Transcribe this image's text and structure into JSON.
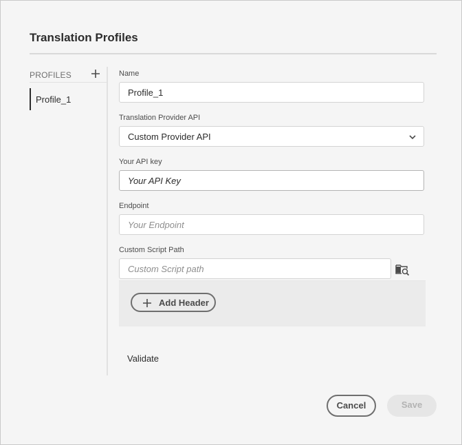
{
  "dialog": {
    "title": "Translation Profiles"
  },
  "sidebar": {
    "header_label": "PROFILES",
    "add_icon": "plus-icon",
    "items": [
      {
        "label": "Profile_1",
        "selected": true
      }
    ]
  },
  "form": {
    "name": {
      "label": "Name",
      "value": "Profile_1"
    },
    "provider": {
      "label": "Translation Provider API",
      "value": "Custom Provider API",
      "icon": "chevron-down-icon"
    },
    "api_key": {
      "label": "Your API key",
      "placeholder": "Your API Key"
    },
    "endpoint": {
      "label": "Endpoint",
      "placeholder": "Your Endpoint"
    },
    "script_path": {
      "label": "Custom Script Path",
      "placeholder": "Custom Script path",
      "browse_icon": "folder-search-icon"
    },
    "add_header_label": "Add Header",
    "validate_label": "Validate"
  },
  "footer": {
    "cancel_label": "Cancel",
    "save_label": "Save",
    "save_enabled": false
  },
  "colors": {
    "background": "#f5f5f5",
    "text": "#2c2c2c",
    "border": "#d3d3d3",
    "disabled": "#e6e6e6"
  }
}
